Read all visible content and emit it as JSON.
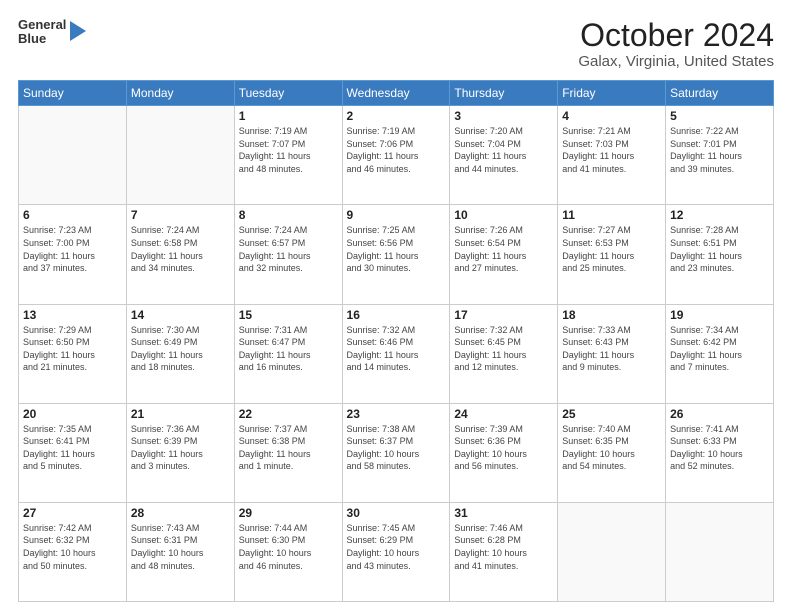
{
  "logo": {
    "line1": "General",
    "line2": "Blue"
  },
  "title": "October 2024",
  "subtitle": "Galax, Virginia, United States",
  "days_of_week": [
    "Sunday",
    "Monday",
    "Tuesday",
    "Wednesday",
    "Thursday",
    "Friday",
    "Saturday"
  ],
  "weeks": [
    [
      {
        "day": "",
        "info": ""
      },
      {
        "day": "",
        "info": ""
      },
      {
        "day": "1",
        "info": "Sunrise: 7:19 AM\nSunset: 7:07 PM\nDaylight: 11 hours\nand 48 minutes."
      },
      {
        "day": "2",
        "info": "Sunrise: 7:19 AM\nSunset: 7:06 PM\nDaylight: 11 hours\nand 46 minutes."
      },
      {
        "day": "3",
        "info": "Sunrise: 7:20 AM\nSunset: 7:04 PM\nDaylight: 11 hours\nand 44 minutes."
      },
      {
        "day": "4",
        "info": "Sunrise: 7:21 AM\nSunset: 7:03 PM\nDaylight: 11 hours\nand 41 minutes."
      },
      {
        "day": "5",
        "info": "Sunrise: 7:22 AM\nSunset: 7:01 PM\nDaylight: 11 hours\nand 39 minutes."
      }
    ],
    [
      {
        "day": "6",
        "info": "Sunrise: 7:23 AM\nSunset: 7:00 PM\nDaylight: 11 hours\nand 37 minutes."
      },
      {
        "day": "7",
        "info": "Sunrise: 7:24 AM\nSunset: 6:58 PM\nDaylight: 11 hours\nand 34 minutes."
      },
      {
        "day": "8",
        "info": "Sunrise: 7:24 AM\nSunset: 6:57 PM\nDaylight: 11 hours\nand 32 minutes."
      },
      {
        "day": "9",
        "info": "Sunrise: 7:25 AM\nSunset: 6:56 PM\nDaylight: 11 hours\nand 30 minutes."
      },
      {
        "day": "10",
        "info": "Sunrise: 7:26 AM\nSunset: 6:54 PM\nDaylight: 11 hours\nand 27 minutes."
      },
      {
        "day": "11",
        "info": "Sunrise: 7:27 AM\nSunset: 6:53 PM\nDaylight: 11 hours\nand 25 minutes."
      },
      {
        "day": "12",
        "info": "Sunrise: 7:28 AM\nSunset: 6:51 PM\nDaylight: 11 hours\nand 23 minutes."
      }
    ],
    [
      {
        "day": "13",
        "info": "Sunrise: 7:29 AM\nSunset: 6:50 PM\nDaylight: 11 hours\nand 21 minutes."
      },
      {
        "day": "14",
        "info": "Sunrise: 7:30 AM\nSunset: 6:49 PM\nDaylight: 11 hours\nand 18 minutes."
      },
      {
        "day": "15",
        "info": "Sunrise: 7:31 AM\nSunset: 6:47 PM\nDaylight: 11 hours\nand 16 minutes."
      },
      {
        "day": "16",
        "info": "Sunrise: 7:32 AM\nSunset: 6:46 PM\nDaylight: 11 hours\nand 14 minutes."
      },
      {
        "day": "17",
        "info": "Sunrise: 7:32 AM\nSunset: 6:45 PM\nDaylight: 11 hours\nand 12 minutes."
      },
      {
        "day": "18",
        "info": "Sunrise: 7:33 AM\nSunset: 6:43 PM\nDaylight: 11 hours\nand 9 minutes."
      },
      {
        "day": "19",
        "info": "Sunrise: 7:34 AM\nSunset: 6:42 PM\nDaylight: 11 hours\nand 7 minutes."
      }
    ],
    [
      {
        "day": "20",
        "info": "Sunrise: 7:35 AM\nSunset: 6:41 PM\nDaylight: 11 hours\nand 5 minutes."
      },
      {
        "day": "21",
        "info": "Sunrise: 7:36 AM\nSunset: 6:39 PM\nDaylight: 11 hours\nand 3 minutes."
      },
      {
        "day": "22",
        "info": "Sunrise: 7:37 AM\nSunset: 6:38 PM\nDaylight: 11 hours\nand 1 minute."
      },
      {
        "day": "23",
        "info": "Sunrise: 7:38 AM\nSunset: 6:37 PM\nDaylight: 10 hours\nand 58 minutes."
      },
      {
        "day": "24",
        "info": "Sunrise: 7:39 AM\nSunset: 6:36 PM\nDaylight: 10 hours\nand 56 minutes."
      },
      {
        "day": "25",
        "info": "Sunrise: 7:40 AM\nSunset: 6:35 PM\nDaylight: 10 hours\nand 54 minutes."
      },
      {
        "day": "26",
        "info": "Sunrise: 7:41 AM\nSunset: 6:33 PM\nDaylight: 10 hours\nand 52 minutes."
      }
    ],
    [
      {
        "day": "27",
        "info": "Sunrise: 7:42 AM\nSunset: 6:32 PM\nDaylight: 10 hours\nand 50 minutes."
      },
      {
        "day": "28",
        "info": "Sunrise: 7:43 AM\nSunset: 6:31 PM\nDaylight: 10 hours\nand 48 minutes."
      },
      {
        "day": "29",
        "info": "Sunrise: 7:44 AM\nSunset: 6:30 PM\nDaylight: 10 hours\nand 46 minutes."
      },
      {
        "day": "30",
        "info": "Sunrise: 7:45 AM\nSunset: 6:29 PM\nDaylight: 10 hours\nand 43 minutes."
      },
      {
        "day": "31",
        "info": "Sunrise: 7:46 AM\nSunset: 6:28 PM\nDaylight: 10 hours\nand 41 minutes."
      },
      {
        "day": "",
        "info": ""
      },
      {
        "day": "",
        "info": ""
      }
    ]
  ]
}
